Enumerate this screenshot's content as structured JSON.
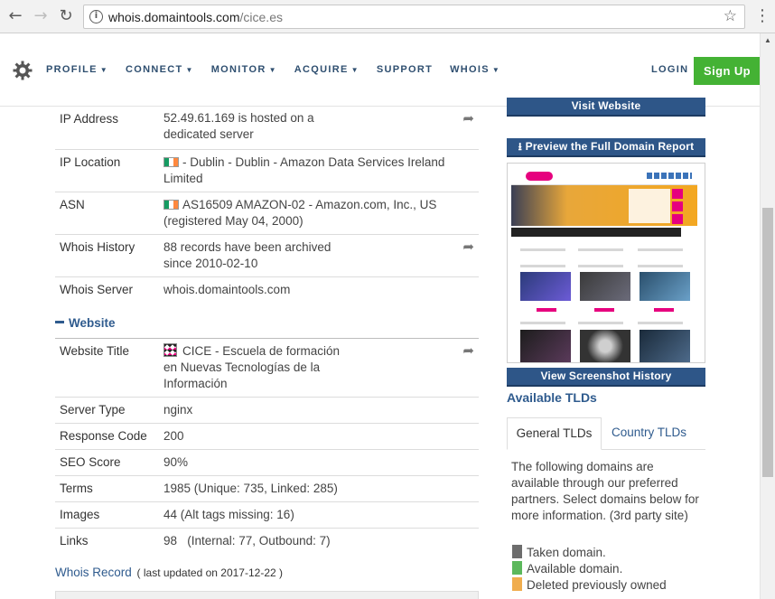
{
  "browser": {
    "url_domain": "whois.domaintools.com",
    "url_path": "/cice.es"
  },
  "nav": {
    "items": [
      "PROFILE",
      "CONNECT",
      "MONITOR",
      "ACQUIRE",
      "SUPPORT",
      "WHOIS"
    ],
    "login": "LOGIN",
    "signup": "Sign Up"
  },
  "server_rows": [
    {
      "label": "IP Address",
      "value_lines": [
        "52.49.61.169 is hosted on a",
        "dedicated server"
      ]
    },
    {
      "label": "IP Location",
      "value_lines": [
        "- Dublin - Dublin - Amazon Data Services Ireland",
        "Limited"
      ]
    },
    {
      "label": "ASN",
      "value_lines": [
        "AS16509 AMAZON-02 - Amazon.com, Inc., US",
        "(registered May 04, 2000)"
      ]
    },
    {
      "label": "Whois History",
      "value_lines": [
        "88 records have been archived",
        "since 2010-02-10"
      ]
    },
    {
      "label": "Whois Server",
      "value_lines": [
        "whois.domaintools.com"
      ]
    }
  ],
  "website_section": {
    "title": "Website",
    "rows": [
      {
        "label": "Website Title",
        "value_lines": [
          "CICE - Escuela de formación",
          "en Nuevas Tecnologías de la",
          "Información"
        ]
      },
      {
        "label": "Server Type",
        "value": "nginx"
      },
      {
        "label": "Response Code",
        "value": "200"
      },
      {
        "label": "SEO Score",
        "value": "90%"
      },
      {
        "label": "Terms",
        "value": "1985 (Unique: 735, Linked: 285)"
      },
      {
        "label": "Images",
        "value": "44 (Alt tags missing: 16)"
      },
      {
        "label": "Links",
        "value": "98   (Internal: 77, Outbound: 7)"
      }
    ]
  },
  "whois_record": {
    "title": "Whois Record",
    "updated": "( last updated on 2017-12-22 )"
  },
  "sidebar": {
    "visit_website": "Visit Website",
    "preview_report": "Preview the Full Domain Report",
    "screenshot_history": "View Screenshot History",
    "available_tlds": "Available TLDs",
    "tabs": [
      "General TLDs",
      "Country TLDs"
    ],
    "tld_description": "The following domains are available through our preferred partners. Select domains below for more information. (3rd party site)",
    "legend": [
      {
        "label": "Taken domain.",
        "color": "#6d6d6d"
      },
      {
        "label": "Available domain.",
        "color": "#5cb85c"
      },
      {
        "label": "Deleted previously owned",
        "color": "#f0ad4e"
      }
    ]
  },
  "colors": {
    "accent_blue": "#2e5688",
    "signup_green": "#44b234",
    "link_blue": "#2f5b8e"
  }
}
